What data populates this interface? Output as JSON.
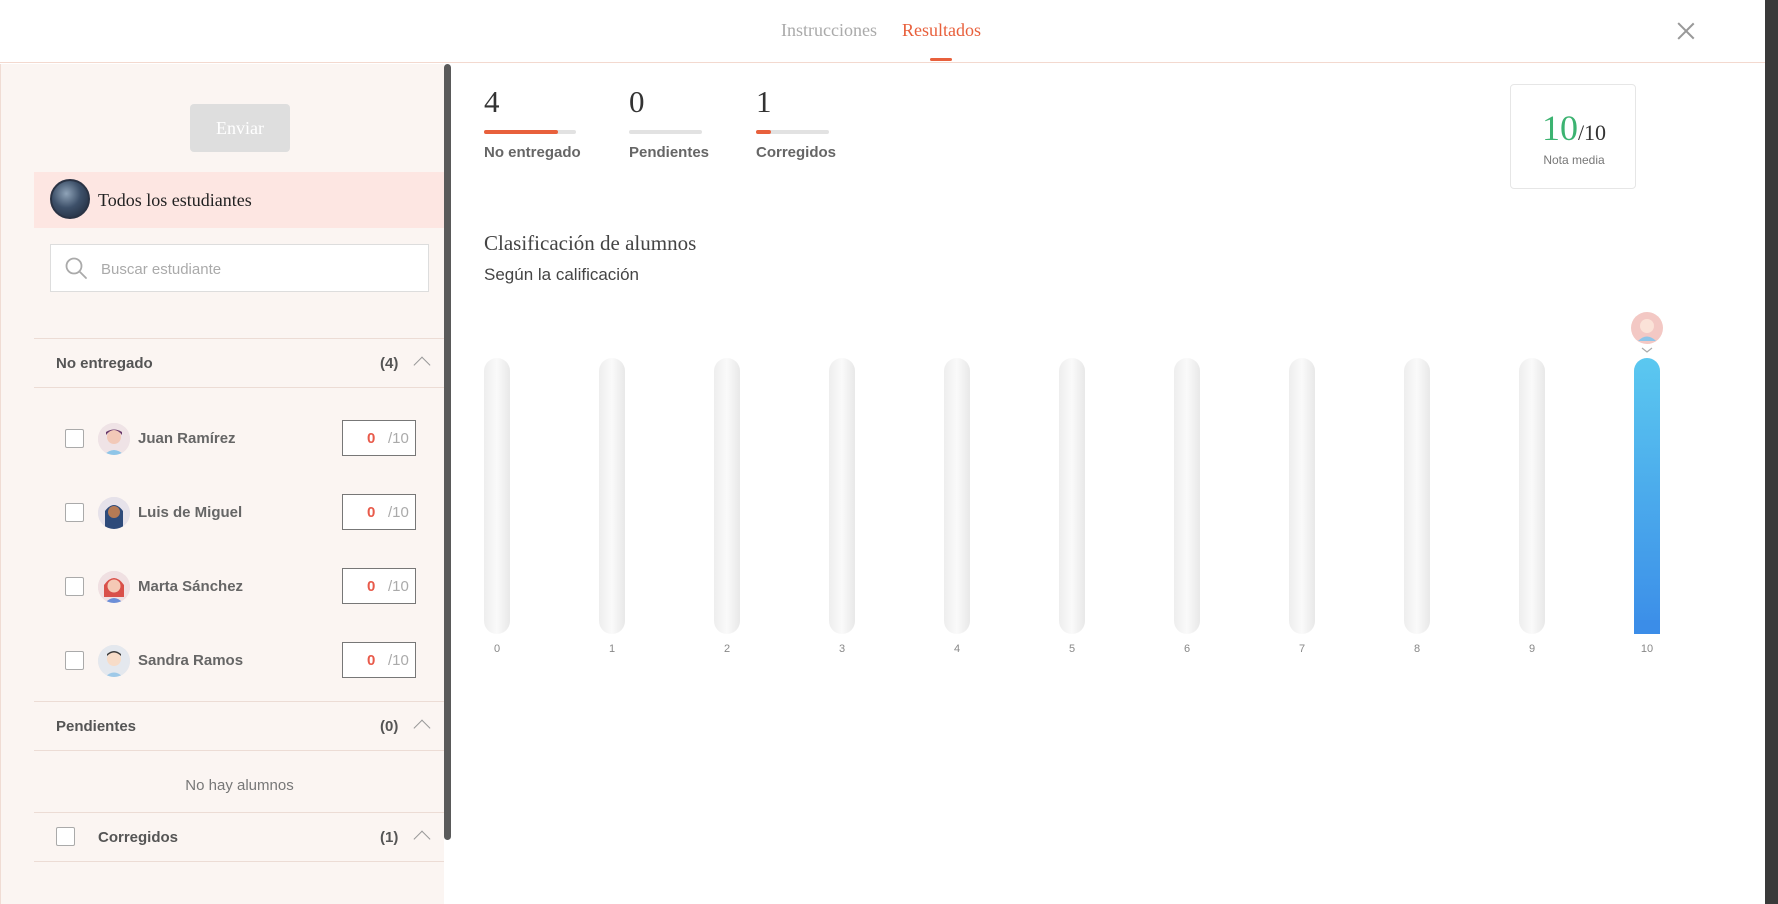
{
  "header": {
    "tabs": [
      {
        "label": "Instrucciones",
        "active": false
      },
      {
        "label": "Resultados",
        "active": true
      }
    ]
  },
  "sidebar": {
    "send_label": "Enviar",
    "all_students_label": "Todos los estudiantes",
    "search_placeholder": "Buscar estudiante",
    "sections": [
      {
        "title": "No entregado",
        "count": "(4)",
        "students": [
          {
            "name": "Juan Ramírez",
            "grade": "0",
            "max": "/10"
          },
          {
            "name": "Luis de Miguel",
            "grade": "0",
            "max": "/10"
          },
          {
            "name": "Marta Sánchez",
            "grade": "0",
            "max": "/10"
          },
          {
            "name": "Sandra Ramos",
            "grade": "0",
            "max": "/10"
          }
        ]
      },
      {
        "title": "Pendientes",
        "count": "(0)",
        "empty_message": "No hay alumnos"
      },
      {
        "title": "Corregidos",
        "count": "(1)"
      }
    ]
  },
  "stats": [
    {
      "value": "4",
      "label": "No entregado",
      "fill": 0.8
    },
    {
      "value": "0",
      "label": "Pendientes",
      "fill": 0
    },
    {
      "value": "1",
      "label": "Corregidos",
      "fill": 0.2
    }
  ],
  "average": {
    "value": "10",
    "max": "/10",
    "label": "Nota media"
  },
  "chart_title": "Clasificación de alumnos",
  "chart_subtitle": "Según la calificación",
  "colors": {
    "accent": "#e8603c",
    "grade_green": "#3cb371",
    "bar_top": "#5bc8f0",
    "bar_bottom": "#3b8de8"
  },
  "chart_data": {
    "type": "bar",
    "categories": [
      "0",
      "1",
      "2",
      "3",
      "4",
      "5",
      "6",
      "7",
      "8",
      "9",
      "10"
    ],
    "values": [
      0,
      0,
      0,
      0,
      0,
      0,
      0,
      0,
      0,
      0,
      1
    ],
    "title": "Clasificación de alumnos",
    "subtitle": "Según la calificación",
    "ylim": [
      0,
      1
    ],
    "grid": false
  }
}
